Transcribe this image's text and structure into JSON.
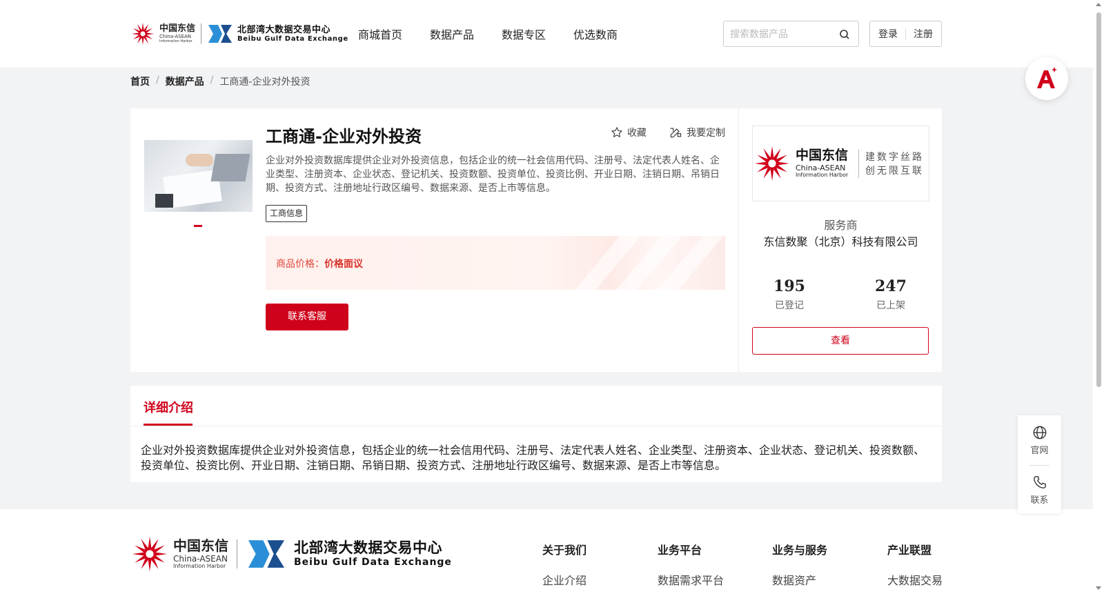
{
  "header": {
    "logo": {
      "china_asean_cn": "中国东信",
      "china_asean_en": "China-ASEAN",
      "info_harbor": "Information Harbor",
      "beibu_cn": "北部湾大数据交易中心",
      "beibu_en": "Beibu Gulf Data Exchange"
    },
    "nav": [
      "商城首页",
      "数据产品",
      "数据专区",
      "优选数商"
    ],
    "search": {
      "placeholder": "搜索数据产品",
      "value": ""
    },
    "login_label": "登录",
    "register_label": "注册"
  },
  "breadcrumb": {
    "home": "首页",
    "products": "数据产品",
    "current": "工商通-企业对外投资"
  },
  "product": {
    "title": "工商通-企业对外投资",
    "favorite_label": "收藏",
    "customize_label": "我要定制",
    "description": "企业对外投资数据库提供企业对外投资信息，包括企业的统一社会信用代码、注册号、法定代表人姓名、企业类型、注册资本、企业状态、登记机关、投资数额、投资单位、投资比例、开业日期、注销日期、吊销日期、投资方式、注册地址行政区编号、数据来源、是否上市等信息。",
    "tag": "工商信息",
    "price_label": "商品价格：",
    "price_value": "价格面议",
    "contact_button": "联系客服"
  },
  "vendor": {
    "logo_cn": "中国东信",
    "logo_en": "China-ASEAN",
    "logo_harbor": "Information Harbor",
    "slogan_line1": "建数字丝路",
    "slogan_line2": "创无限互联",
    "service_label": "服务商",
    "name": "东信数聚（北京）科技有限公司",
    "registered_count": "195",
    "registered_label": "已登记",
    "listed_count": "247",
    "listed_label": "已上架",
    "view_button": "查看"
  },
  "detail": {
    "tab_label": "详细介绍",
    "body": "企业对外投资数据库提供企业对外投资信息，包括企业的统一社会信用代码、注册号、法定代表人姓名、企业类型、注册资本、企业状态、登记机关、投资数额、投资单位、投资比例、开业日期、注销日期、吊销日期、投资方式、注册地址行政区编号、数据来源、是否上市等信息。"
  },
  "footer": {
    "columns": [
      {
        "heading": "关于我们",
        "first_item": "企业介绍"
      },
      {
        "heading": "业务平台",
        "first_item": "数据需求平台"
      },
      {
        "heading": "业务与服务",
        "first_item": "数据资产"
      },
      {
        "heading": "产业联盟",
        "first_item": "大数据交易"
      }
    ]
  },
  "side": {
    "website_label": "官网",
    "contact_label": "联系"
  },
  "colors": {
    "brand_red": "#d0021b",
    "price_red": "#e0453a",
    "beibu_blue": "#2a8fd6"
  },
  "icons": [
    "search-icon",
    "star-icon",
    "customize-icon",
    "globe-icon",
    "phone-icon",
    "assistant-a-icon"
  ]
}
